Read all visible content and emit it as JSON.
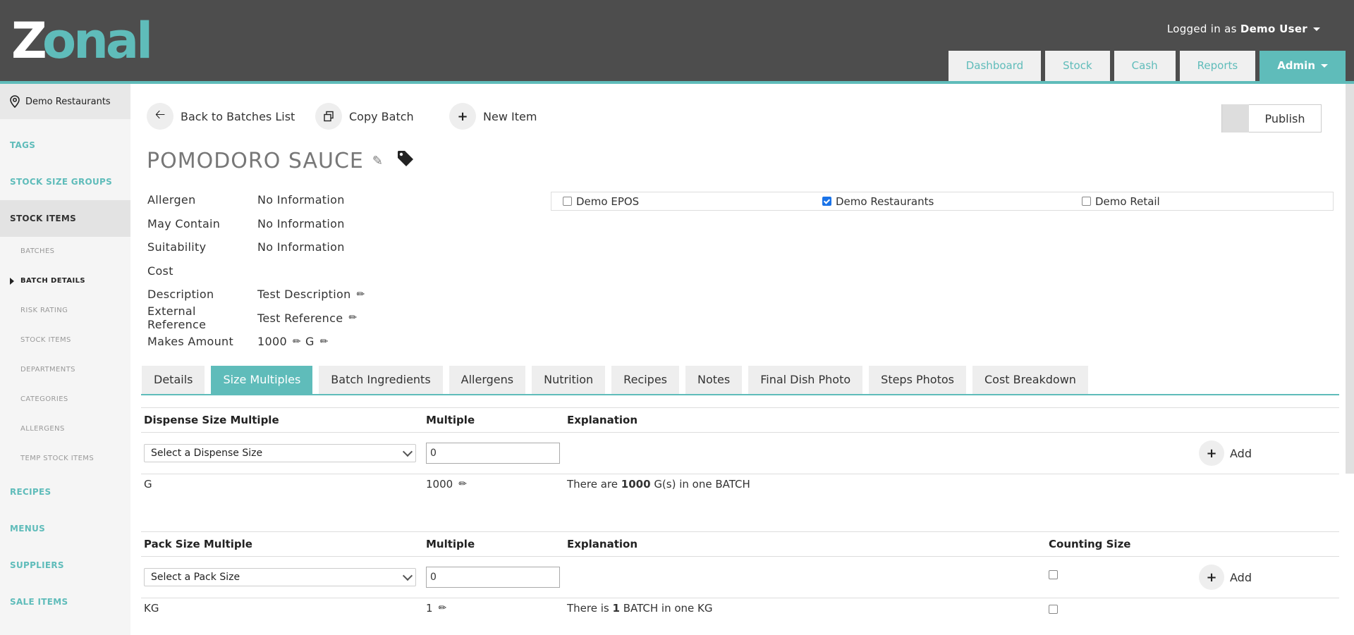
{
  "header": {
    "logo_text": "Zonal",
    "login_prefix": "Logged in as",
    "login_user": "Demo User",
    "nav": [
      {
        "label": "Dashboard"
      },
      {
        "label": "Stock"
      },
      {
        "label": "Cash"
      },
      {
        "label": "Reports"
      },
      {
        "label": "Admin"
      }
    ]
  },
  "sidebar": {
    "venue": "Demo Restaurants",
    "tags": "TAGS",
    "stock_size_groups": "STOCK SIZE GROUPS",
    "stock_items": "STOCK ITEMS",
    "sub": [
      {
        "label": "BATCHES"
      },
      {
        "label": "BATCH DETAILS"
      },
      {
        "label": "RISK RATING"
      },
      {
        "label": "STOCK ITEMS"
      },
      {
        "label": "DEPARTMENTS"
      },
      {
        "label": "CATEGORIES"
      },
      {
        "label": "ALLERGENS"
      },
      {
        "label": "TEMP STOCK ITEMS"
      }
    ],
    "recipes": "RECIPES",
    "menus": "MENUS",
    "suppliers": "SUPPLIERS",
    "sale_items": "SALE ITEMS"
  },
  "actions": {
    "back": "Back to Batches List",
    "copy": "Copy Batch",
    "new_item": "New Item",
    "publish": "Publish"
  },
  "batch": {
    "title": "POMODORO SAUCE",
    "allergen_label": "Allergen",
    "allergen_value": "No Information",
    "may_contain_label": "May Contain",
    "may_contain_value": "No Information",
    "suitability_label": "Suitability",
    "suitability_value": "No Information",
    "cost_label": "Cost",
    "description_label": "Description",
    "description_value": "Test Description",
    "ext_ref_label": "External Reference",
    "ext_ref_value": "Test Reference",
    "makes_label": "Makes Amount",
    "makes_amount": "1000",
    "makes_unit": "G"
  },
  "venues": [
    {
      "label": "Demo EPOS",
      "checked": false
    },
    {
      "label": "Demo Restaurants",
      "checked": true
    },
    {
      "label": "Demo Retail",
      "checked": false
    }
  ],
  "tabs": [
    {
      "label": "Details"
    },
    {
      "label": "Size Multiples"
    },
    {
      "label": "Batch Ingredients"
    },
    {
      "label": "Allergens"
    },
    {
      "label": "Nutrition"
    },
    {
      "label": "Recipes"
    },
    {
      "label": "Notes"
    },
    {
      "label": "Final Dish Photo"
    },
    {
      "label": "Steps Photos"
    },
    {
      "label": "Cost Breakdown"
    }
  ],
  "dispense": {
    "headers": {
      "col1": "Dispense Size Multiple",
      "col2": "Multiple",
      "col3": "Explanation"
    },
    "select_placeholder": "Select a Dispense Size",
    "input_value": "0",
    "add_label": "Add",
    "row": {
      "size": "G",
      "multiple": "1000",
      "exp_pre": "There are",
      "exp_num": "1000",
      "exp_post": "G(s) in one BATCH"
    }
  },
  "pack": {
    "headers": {
      "col1": "Pack Size Multiple",
      "col2": "Multiple",
      "col3": "Explanation",
      "col4": "Counting Size"
    },
    "select_placeholder": "Select a Pack Size",
    "input_value": "0",
    "add_label": "Add",
    "row": {
      "size": "KG",
      "multiple": "1",
      "exp_pre": "There is",
      "exp_num": "1",
      "exp_post": "BATCH in one KG"
    }
  }
}
